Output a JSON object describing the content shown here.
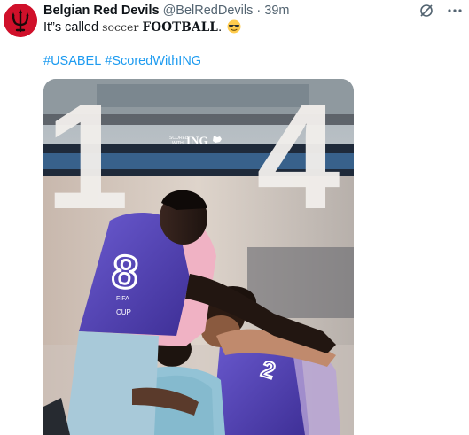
{
  "tweet": {
    "display_name": "Belgian Red Devils",
    "handle": "@BelRedDevils",
    "separator": "·",
    "time": "39m",
    "text": {
      "prefix": "It”s called ",
      "struck": "soccer",
      "bold": "FOOTBALL",
      "suffix": ".",
      "emoji": "sunglasses-emoji"
    },
    "hashtags": [
      "#USABEL",
      "#ScoredWithING"
    ]
  },
  "media": {
    "big_numbers": [
      "1",
      "4"
    ],
    "sponsor_small": [
      "SCORED",
      "WITH"
    ],
    "sponsor_brand": "ING",
    "jersey_number": "8",
    "jersey_text": [
      "FIFA",
      "CUP"
    ]
  },
  "colors": {
    "accent": "#1d9bf0",
    "avatar_bg": "#d0102a",
    "vest": "#5a49b8"
  },
  "icons": {
    "grok": "grok-icon",
    "more": "more-icon"
  }
}
